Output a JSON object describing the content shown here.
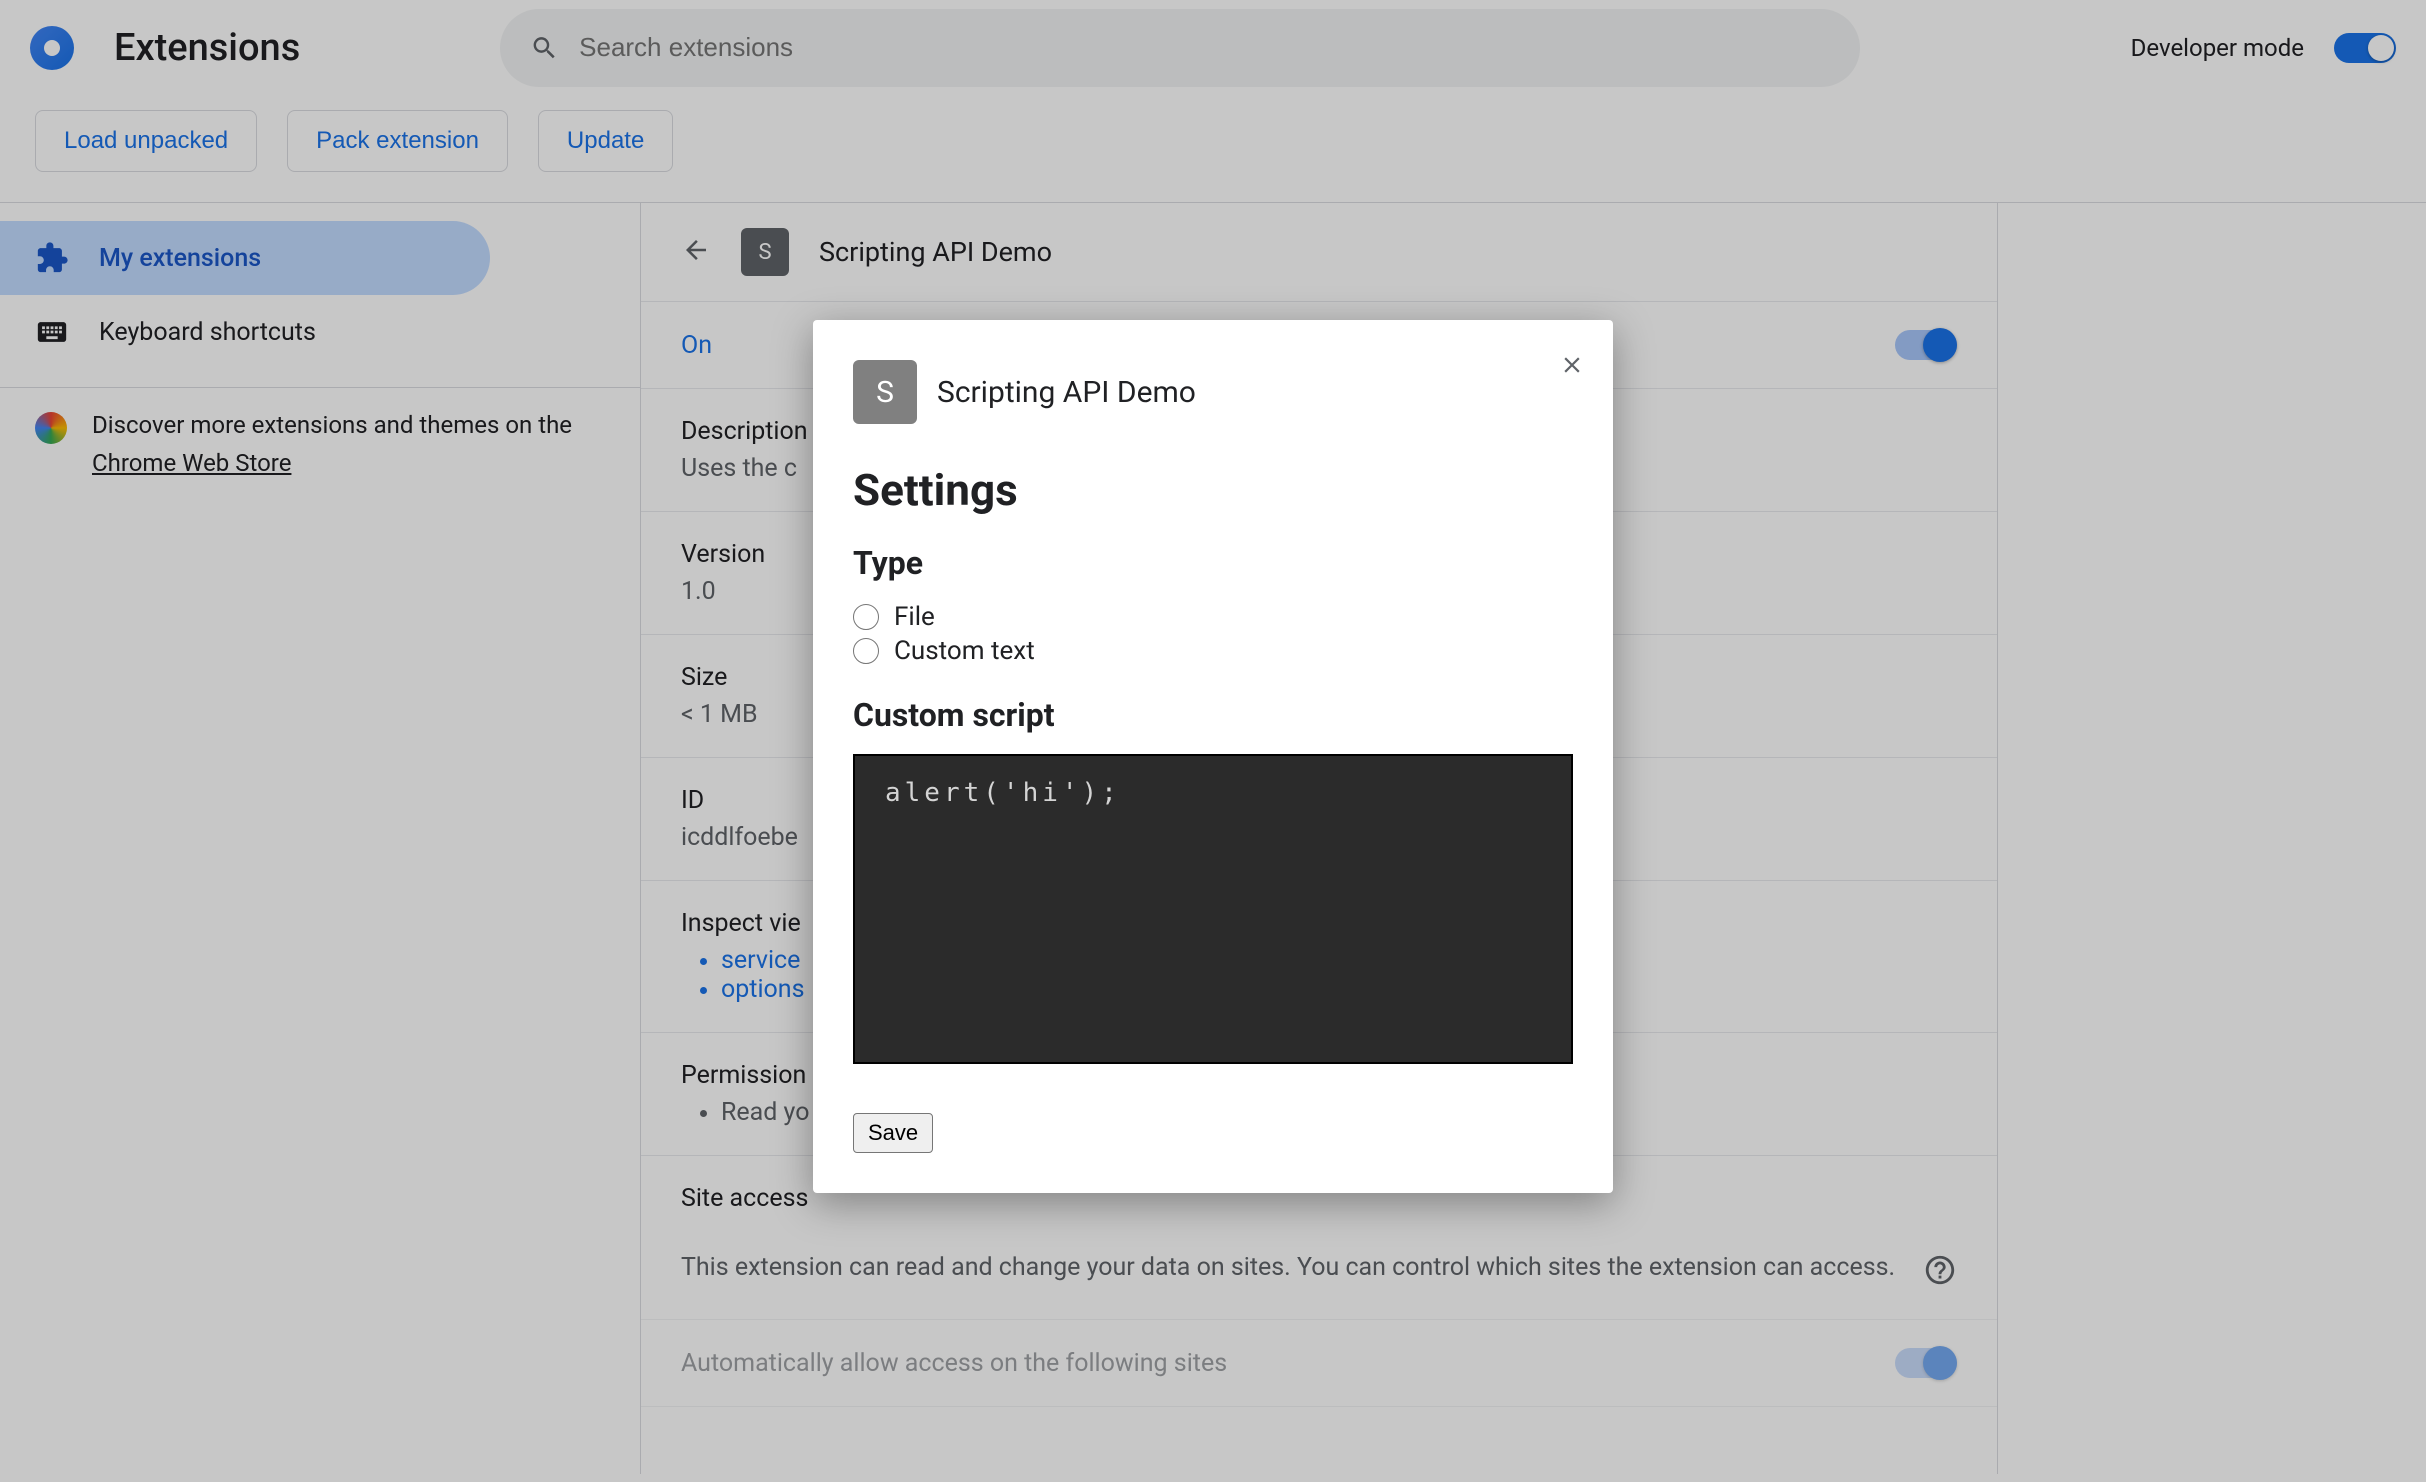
{
  "header": {
    "title": "Extensions",
    "search_placeholder": "Search extensions",
    "dev_mode_label": "Developer mode"
  },
  "toolbar": {
    "load_unpacked": "Load unpacked",
    "pack_extension": "Pack extension",
    "update": "Update"
  },
  "sidebar": {
    "my_extensions": "My extensions",
    "keyboard_shortcuts": "Keyboard shortcuts",
    "discover_pre": "Discover more extensions and themes on the ",
    "discover_link": "Chrome Web Store"
  },
  "detail": {
    "title": "Scripting API Demo",
    "badge": "S",
    "on_label": "On",
    "desc_label": "Description",
    "desc_value": "Uses the c",
    "version_label": "Version",
    "version_value": "1.0",
    "size_label": "Size",
    "size_value": "< 1 MB",
    "id_label": "ID",
    "id_value": "icddlfoebe",
    "inspect_label": "Inspect vie",
    "inspect_items": [
      "service",
      "options"
    ],
    "perm_label": "Permission",
    "perm_items": [
      "Read yo"
    ],
    "site_access_label": "Site access",
    "site_access_desc": "This extension can read and change your data on sites. You can control which sites the extension can access.",
    "auto_allow": "Automatically allow access on the following sites"
  },
  "dialog": {
    "badge": "S",
    "title": "Scripting API Demo",
    "settings_heading": "Settings",
    "type_heading": "Type",
    "radio_file": "File",
    "radio_custom": "Custom text",
    "script_heading": "Custom script",
    "script_value": "alert('hi');",
    "save": "Save"
  }
}
